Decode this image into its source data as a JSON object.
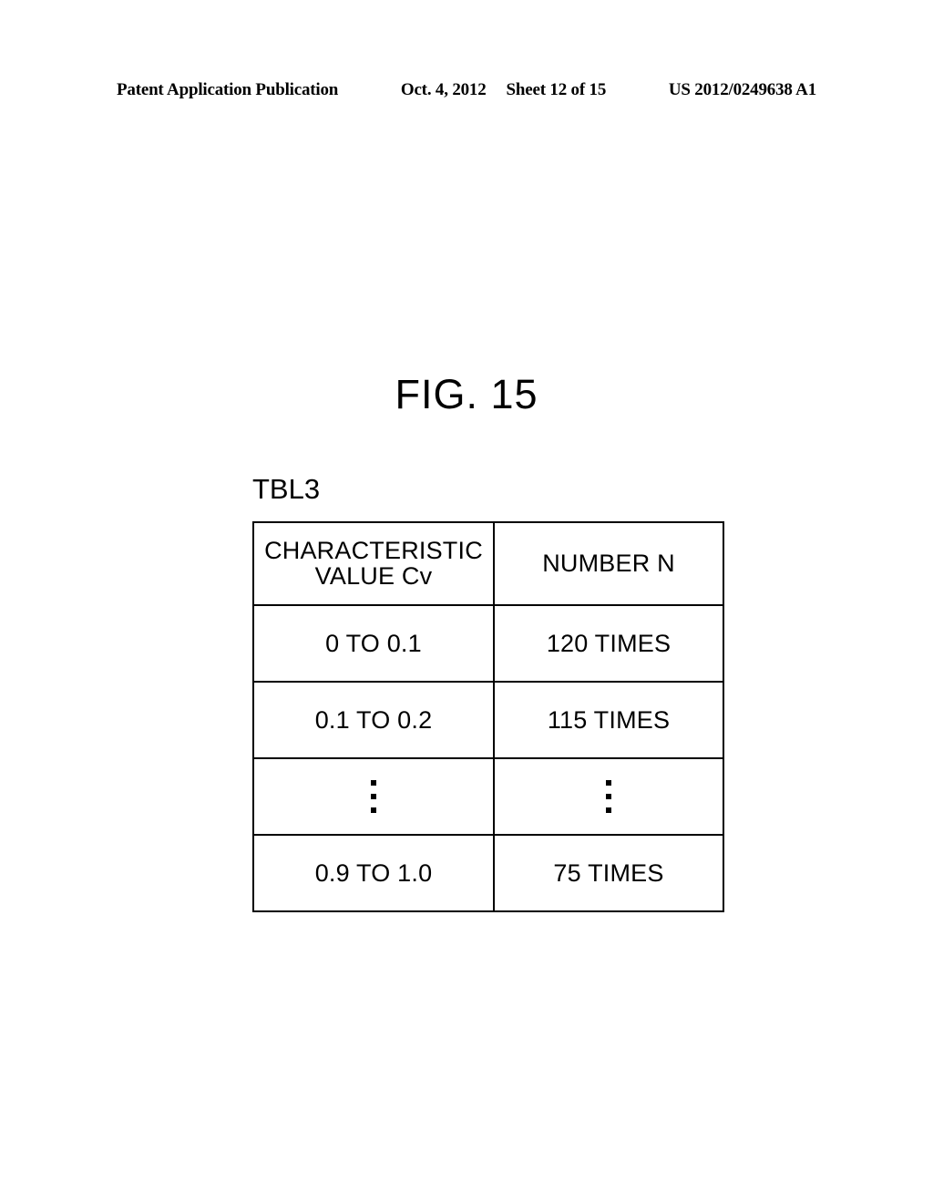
{
  "header": {
    "publication": "Patent Application Publication",
    "date": "Oct. 4, 2012",
    "sheet": "Sheet 12 of 15",
    "patent_number": "US 2012/0249638 A1"
  },
  "figure": {
    "title": "FIG. 15",
    "table_label": "TBL3"
  },
  "chart_data": {
    "type": "table",
    "title": "TBL3",
    "columns": [
      "CHARACTERISTIC VALUE Cv",
      "NUMBER N"
    ],
    "column_header_lines": [
      [
        "CHARACTERISTIC",
        "VALUE Cv"
      ],
      [
        "NUMBER N"
      ]
    ],
    "rows": [
      {
        "cv": "0 TO 0.1",
        "n": "120 TIMES"
      },
      {
        "cv": "0.1 TO 0.2",
        "n": "115 TIMES"
      },
      {
        "cv": "⋮",
        "n": "⋮"
      },
      {
        "cv": "0.9 TO 1.0",
        "n": "75 TIMES"
      }
    ],
    "categories": [
      "0 TO 0.1",
      "0.1 TO 0.2",
      "0.9 TO 1.0"
    ],
    "values": [
      120,
      115,
      75
    ],
    "xlabel": "CHARACTERISTIC VALUE Cv",
    "ylabel": "NUMBER N"
  }
}
